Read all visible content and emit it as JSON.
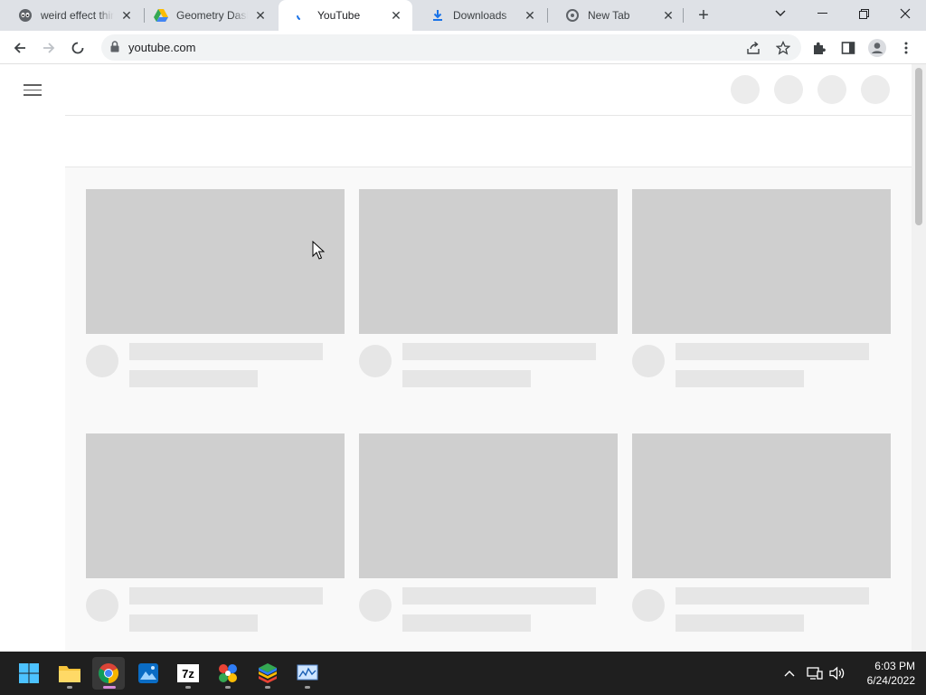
{
  "tabs": [
    {
      "title": "weird effect thin",
      "icon": "alien-face-icon"
    },
    {
      "title": "Geometry Dash",
      "icon": "google-drive-icon"
    },
    {
      "title": "YouTube",
      "icon": "loading-spinner-icon",
      "active": true
    },
    {
      "title": "Downloads",
      "icon": "download-icon"
    },
    {
      "title": "New Tab",
      "icon": "new-tab-icon"
    }
  ],
  "toolbar": {
    "url": "youtube.com"
  },
  "taskbar": {
    "time": "6:03 PM",
    "date": "6/24/2022",
    "apps": [
      "windows-start-icon",
      "file-explorer-icon",
      "chrome-icon",
      "photos-icon",
      "7zip-icon",
      "colorful-app-icon",
      "bluestacks-icon",
      "monitor-app-icon"
    ]
  },
  "colors": {
    "tabstrip": "#dee1e6",
    "skeleton_thumb": "#cfcfcf",
    "skeleton_line": "#e6e6e6",
    "taskbar": "#1f1f1f",
    "accent_active_app": "#d68bd8"
  }
}
